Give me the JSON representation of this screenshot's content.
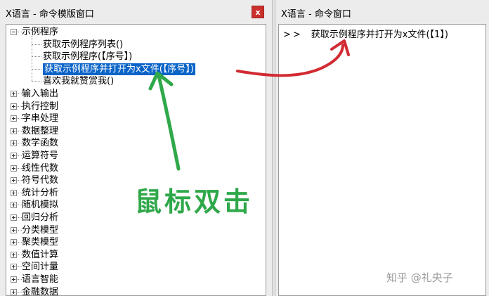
{
  "left_window": {
    "title": "X语言 - 命令模版窗口",
    "close_label": "x"
  },
  "right_window": {
    "title": "X语言 - 命令窗口"
  },
  "tree": {
    "root": {
      "label": "示例程序",
      "children": [
        "获取示例程序列表()",
        "获取示例程序(【序号】)",
        "获取示例程序并打开为x文件(【序号】)",
        "喜欢我就赞赏我()"
      ]
    },
    "selected_child": 2,
    "categories": [
      "输入输出",
      "执行控制",
      "字串处理",
      "数据整理",
      "数学函数",
      "运算符号",
      "线性代数",
      "符号代数",
      "统计分析",
      "随机模拟",
      "回归分析",
      "分类模型",
      "聚类模型",
      "数值计算",
      "空间计量",
      "语言智能",
      "金融数据"
    ]
  },
  "command_window": {
    "prompt": ">>",
    "command": "获取示例程序并打开为x文件(【1】)"
  },
  "annotation": {
    "text": "鼠标双击",
    "color": "#2fa84a"
  },
  "arrow_colors": {
    "red": "#d22b33",
    "green": "#2fa84a"
  },
  "watermark": {
    "text": "知乎 @礼央子"
  }
}
